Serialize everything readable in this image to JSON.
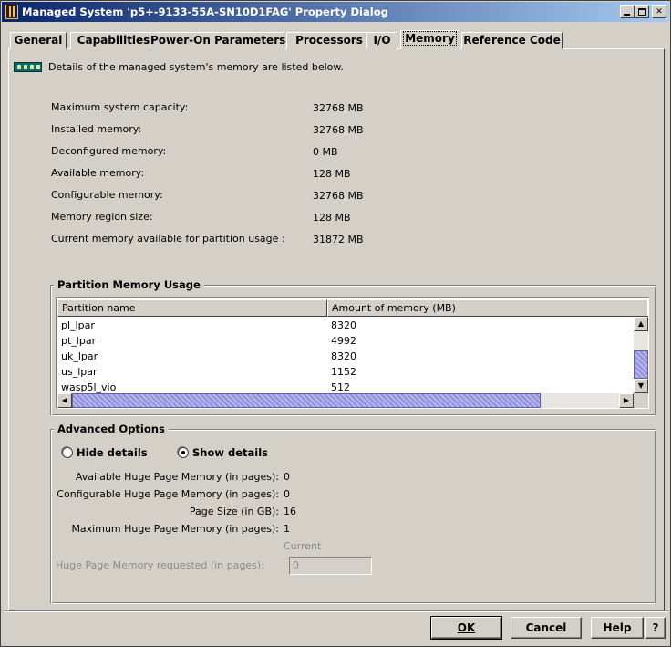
{
  "window": {
    "title": "Managed System 'p5+-9133-55A-SN10D1FAG' Property Dialog",
    "controls": {
      "minimize": "_",
      "maximize": "□",
      "close": "✕"
    }
  },
  "tabs": [
    {
      "label": "General"
    },
    {
      "label": "Capabilities"
    },
    {
      "label": "Power-On Parameters"
    },
    {
      "label": "Processors"
    },
    {
      "label": "I/O"
    },
    {
      "label": "Memory",
      "active": true
    },
    {
      "label": "Reference Code"
    }
  ],
  "memory": {
    "description": "Details of the managed system's memory are listed below.",
    "details": [
      {
        "label": "Maximum system capacity:",
        "value": "32768 MB"
      },
      {
        "label": "Installed memory:",
        "value": "32768 MB"
      },
      {
        "label": "Deconfigured memory:",
        "value": "0 MB"
      },
      {
        "label": "Available memory:",
        "value": "128 MB"
      },
      {
        "label": "Configurable memory:",
        "value": "32768 MB"
      },
      {
        "label": "Memory region size:",
        "value": "128 MB"
      },
      {
        "label": "Current memory available for partition usage :",
        "value": "31872 MB"
      }
    ]
  },
  "partition_usage": {
    "title": "Partition Memory Usage",
    "columns": [
      "Partition name",
      "Amount of memory (MB)"
    ],
    "rows": [
      {
        "name": "pl_lpar",
        "memory": "8320"
      },
      {
        "name": "pt_lpar",
        "memory": "4992"
      },
      {
        "name": "uk_lpar",
        "memory": "8320"
      },
      {
        "name": "us_lpar",
        "memory": "1152"
      },
      {
        "name": "wasp5l_vio",
        "memory": "512"
      }
    ],
    "scroll": {
      "up": "▲",
      "down": "▼",
      "left": "◀",
      "right": "▶"
    }
  },
  "advanced": {
    "title": "Advanced Options",
    "radios": [
      {
        "label": "Hide details",
        "selected": false
      },
      {
        "label": "Show details",
        "selected": true
      }
    ],
    "fields": [
      {
        "label": "Available Huge Page Memory (in pages):",
        "value": "0"
      },
      {
        "label": "Configurable Huge Page Memory (in pages):",
        "value": "0"
      },
      {
        "label": "Page Size (in GB):",
        "value": "16"
      },
      {
        "label": "Maximum Huge Page Memory (in pages):",
        "value": "1"
      }
    ],
    "current_header": "Current",
    "requested_label": "Huge Page Memory requested (in pages):",
    "requested_value": "0"
  },
  "buttons": {
    "ok": "OK",
    "cancel": "Cancel",
    "help": "Help",
    "question": "?"
  }
}
